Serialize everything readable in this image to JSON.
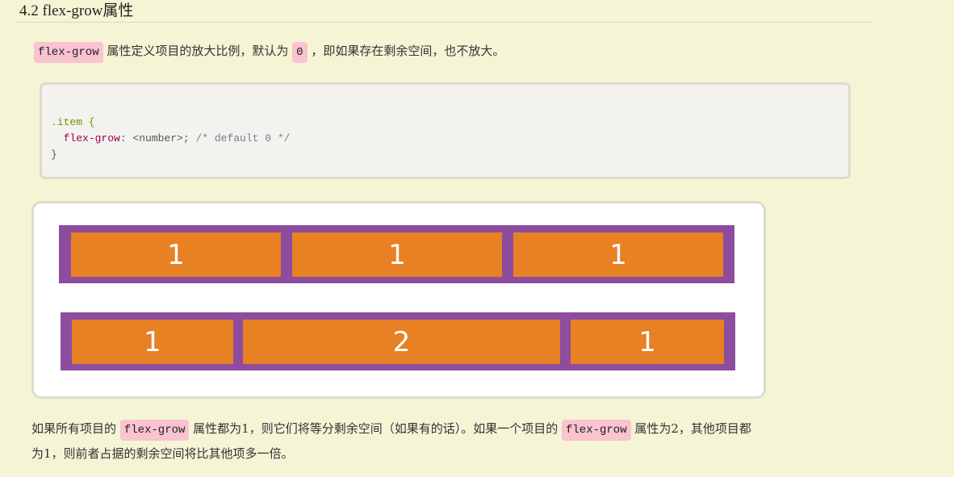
{
  "heading": "4.2 flex-grow属性",
  "intro": {
    "code1": "flex-grow",
    "text1": " 属性定义项目的放大比例，默认为 ",
    "code2": "0",
    "text2": " ，即如果存在剩余空间，也不放大。"
  },
  "codeblock": {
    "selector": ".item {",
    "property": "flex-grow",
    "value": ": <number>; ",
    "comment": "/* default 0 */",
    "close": "}"
  },
  "demo": {
    "row1": [
      "1",
      "1",
      "1"
    ],
    "row2": [
      "1",
      "2",
      "1"
    ],
    "colors": {
      "container": "#8e4c9e",
      "item": "#e88024"
    }
  },
  "outro": {
    "t1": "如果所有项目的 ",
    "code1": "flex-grow",
    "t2": " 属性都为1，则它们将等分剩余空间（如果有的话）。如果一个项目的 ",
    "code2": "flex-grow",
    "t3": " 属性为2，其他项目都",
    "line2": "为1，则前者占据的剩余空间将比其他项多一倍。"
  }
}
